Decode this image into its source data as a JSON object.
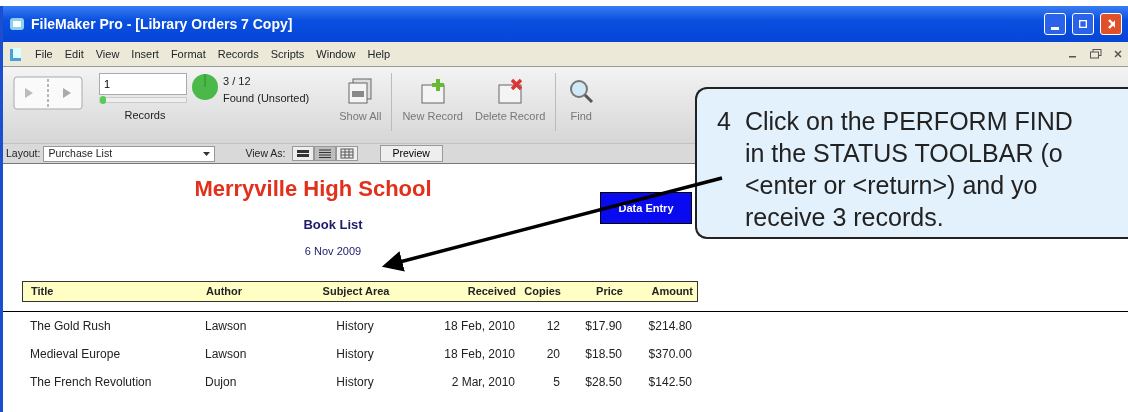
{
  "window": {
    "title": "FileMaker Pro - [Library Orders 7 Copy]"
  },
  "menu": {
    "items": [
      "File",
      "Edit",
      "View",
      "Insert",
      "Format",
      "Records",
      "Scripts",
      "Window",
      "Help"
    ]
  },
  "toolbar": {
    "record_number": "1",
    "record_slider": {
      "level": 0
    },
    "records_label": "Records",
    "found_count": "3 / 12",
    "found_status": "Found (Unsorted)",
    "buttons": [
      {
        "kind": "showall",
        "label": "Show All"
      },
      {
        "kind": "newrecord",
        "label": "New Record"
      },
      {
        "kind": "deleterecord",
        "label": "Delete Record"
      },
      {
        "kind": "find",
        "label": "Find"
      }
    ]
  },
  "layout_bar": {
    "layout_label": "Layout:",
    "layout_value": "Purchase List",
    "view_as_label": "View As:",
    "view_modes": [
      {
        "kind": "form",
        "selected": false
      },
      {
        "kind": "list",
        "selected": true
      },
      {
        "kind": "table",
        "selected": false
      }
    ],
    "preview_button": "Preview"
  },
  "report": {
    "school_name": "Merryville High School",
    "subtitle": "Book List",
    "date": "6 Nov 2009",
    "data_entry_button": "Data Entry",
    "columns": [
      "Title",
      "Author",
      "Subject Area",
      "Received",
      "Copies",
      "Price",
      "Amount"
    ],
    "rows": [
      [
        "The Gold Rush",
        "Lawson",
        "History",
        "18 Feb, 2010",
        "12",
        "$17.90",
        "$214.80"
      ],
      [
        "Medieval Europe",
        "Lawson",
        "History",
        "18 Feb, 2010",
        "20",
        "$18.50",
        "$370.00"
      ],
      [
        "The French Revolution",
        "Dujon",
        "History",
        "2 Mar, 2010",
        "5",
        "$28.50",
        "$142.50"
      ]
    ]
  },
  "callout": {
    "step": "4",
    "lines": [
      "Click on the PERFORM FIND",
      "in the STATUS TOOLBAR (o",
      "<enter or <return>) and yo",
      "receive 3 records."
    ]
  }
}
